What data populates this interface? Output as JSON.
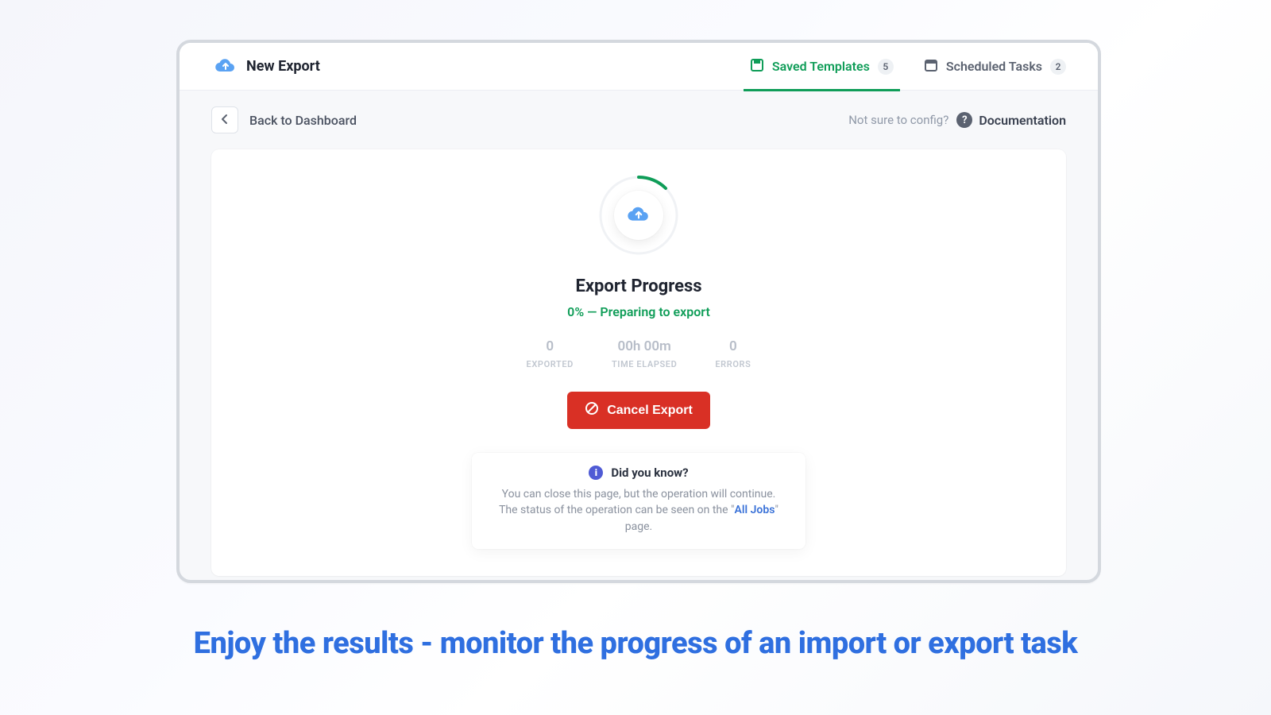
{
  "header": {
    "title": "New Export",
    "tabs": {
      "saved": {
        "label": "Saved Templates",
        "count": "5"
      },
      "scheduled": {
        "label": "Scheduled Tasks",
        "count": "2"
      }
    }
  },
  "subheader": {
    "back_label": "Back to Dashboard",
    "help_text": "Not sure to config?",
    "doc_label": "Documentation"
  },
  "progress": {
    "title": "Export Progress",
    "status": "0% — Preparing to export",
    "metrics": {
      "exported": {
        "value": "0",
        "label": "EXPORTED"
      },
      "elapsed": {
        "value": "00h 00m",
        "label": "TIME ELAPSED"
      },
      "errors": {
        "value": "0",
        "label": "ERRORS"
      }
    },
    "cancel_label": "Cancel Export"
  },
  "tip": {
    "heading": "Did you know?",
    "line1": "You can close this page, but the operation will continue.",
    "line2_pre": "The status of the operation can be seen on the \"",
    "line2_link": "All Jobs",
    "line2_post": "\" page."
  },
  "caption": "Enjoy the results - monitor the progress of an import or export task"
}
